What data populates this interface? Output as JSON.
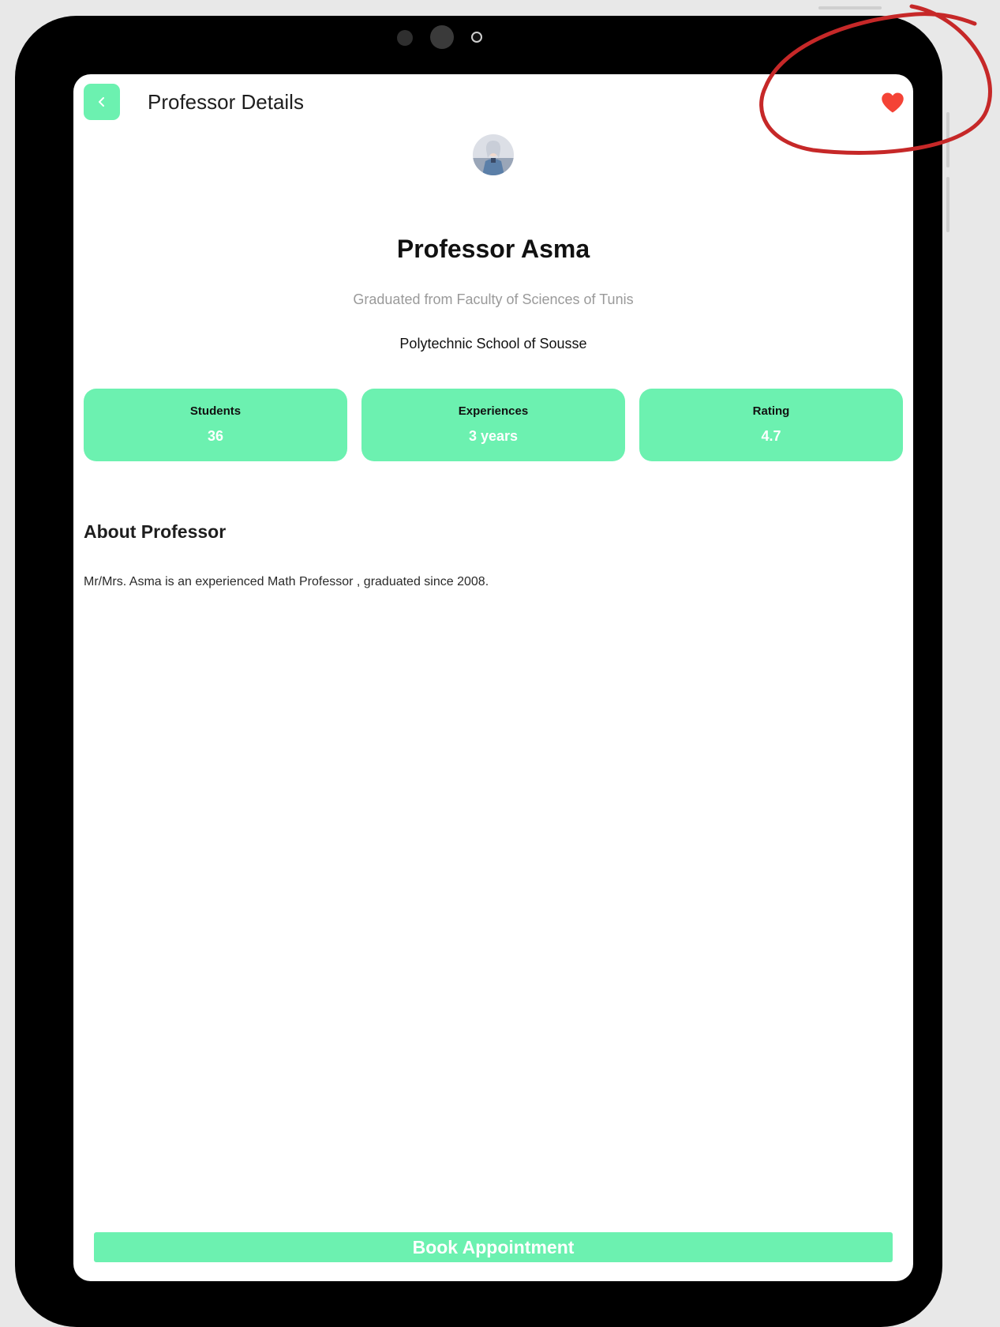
{
  "header": {
    "title": "Professor Details",
    "back_icon": "chevron-left-icon",
    "favorite_icon": "heart-icon",
    "favorite_color": "#f44336"
  },
  "profile": {
    "name": "Professor Asma",
    "graduated": "Graduated from Faculty of Sciences of Tunis",
    "school": "Polytechnic School of Sousse"
  },
  "stats": [
    {
      "label": "Students",
      "value": "36"
    },
    {
      "label": "Experiences",
      "value": "3 years"
    },
    {
      "label": "Rating",
      "value": "4.7"
    }
  ],
  "about": {
    "heading": "About Professor",
    "text": "Mr/Mrs. Asma is an experienced Math Professor , graduated since 2008."
  },
  "actions": {
    "book_label": "Book Appointment"
  },
  "colors": {
    "accent": "#6cf1b0",
    "annotation": "#c62828"
  }
}
